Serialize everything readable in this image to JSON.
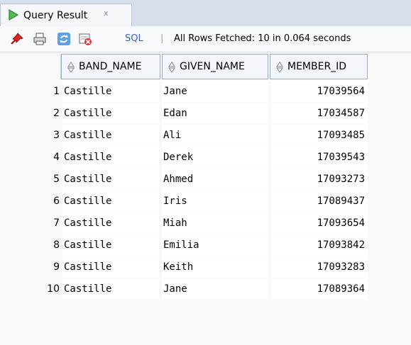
{
  "tab": {
    "title": "Query Result",
    "close_symbol": "x"
  },
  "toolbar": {
    "icons": [
      "pin-icon",
      "print-icon",
      "refresh-icon",
      "delete-icon"
    ],
    "sql_label": "SQL",
    "separator": "|",
    "status": "All Rows Fetched: 10 in 0.064 seconds"
  },
  "grid": {
    "columns": [
      "BAND_NAME",
      "GIVEN_NAME",
      "MEMBER_ID"
    ],
    "rows": [
      {
        "n": "1",
        "band": "Castille",
        "given": "Jane",
        "id": "17039564"
      },
      {
        "n": "2",
        "band": "Castille",
        "given": "Edan",
        "id": "17034587"
      },
      {
        "n": "3",
        "band": "Castille",
        "given": "Ali",
        "id": "17093485"
      },
      {
        "n": "4",
        "band": "Castille",
        "given": "Derek",
        "id": "17039543"
      },
      {
        "n": "5",
        "band": "Castille",
        "given": "Ahmed",
        "id": "17093273"
      },
      {
        "n": "6",
        "band": "Castille",
        "given": "Iris",
        "id": "17089437"
      },
      {
        "n": "7",
        "band": "Castille",
        "given": "Miah",
        "id": "17093654"
      },
      {
        "n": "8",
        "band": "Castille",
        "given": "Emilia",
        "id": "17093842"
      },
      {
        "n": "9",
        "band": "Castille",
        "given": "Keith",
        "id": "17093283"
      },
      {
        "n": "10",
        "band": "Castille",
        "given": "Jane",
        "id": "17089364"
      }
    ]
  }
}
